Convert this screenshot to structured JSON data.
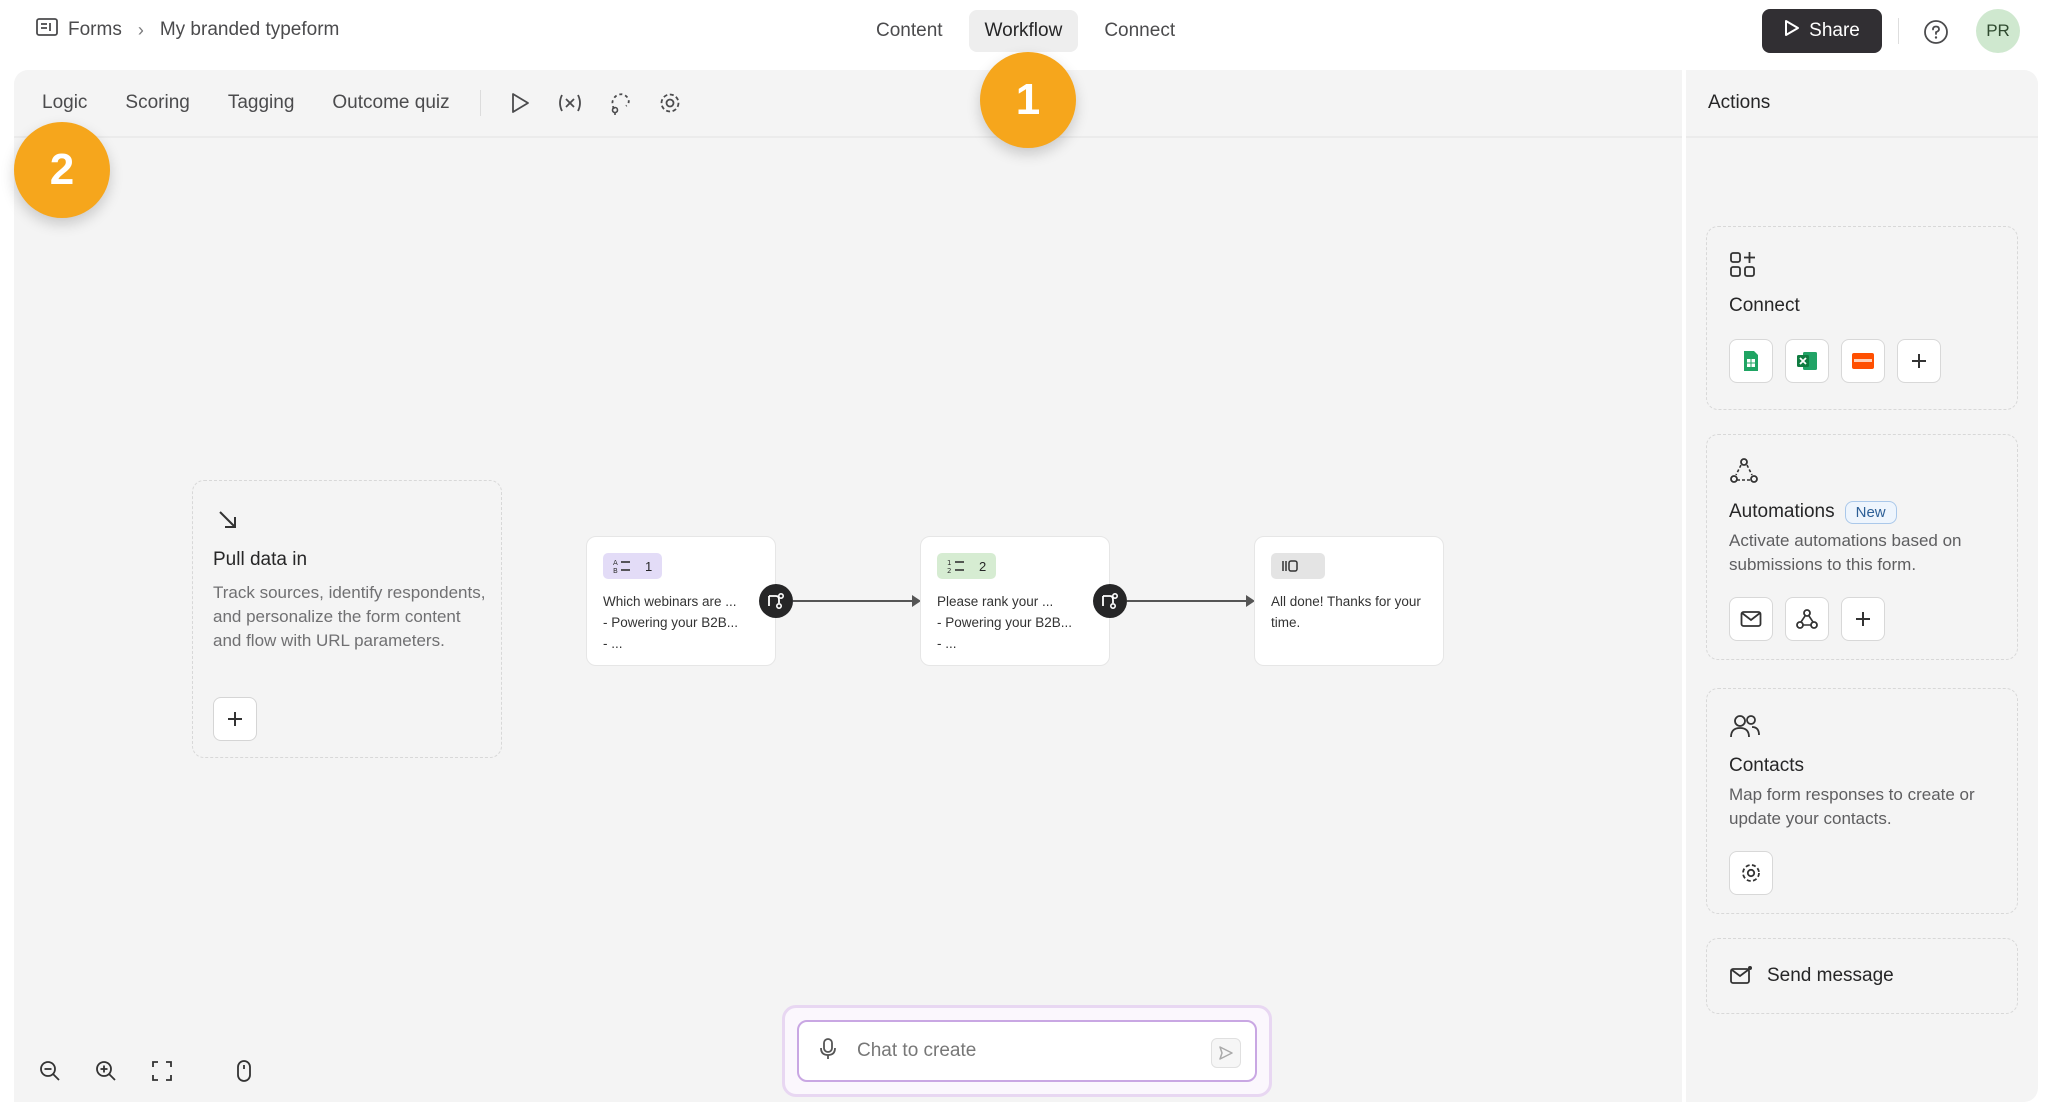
{
  "header": {
    "breadcrumb_root": "Forms",
    "breadcrumb_separator": "›",
    "breadcrumb_current": "My branded typeform",
    "tabs": [
      {
        "label": "Content"
      },
      {
        "label": "Workflow",
        "active": true
      },
      {
        "label": "Connect"
      }
    ],
    "share_label": "Share",
    "avatar_initials": "PR"
  },
  "subnav": {
    "tabs": [
      {
        "label": "Logic"
      },
      {
        "label": "Scoring"
      },
      {
        "label": "Tagging"
      },
      {
        "label": "Outcome quiz"
      }
    ]
  },
  "badges": {
    "one": "1",
    "two": "2",
    "color": "#f6a61c"
  },
  "pull_data": {
    "title": "Pull data in",
    "description": "Track sources, identify respondents, and personalize the form content and flow with URL parameters."
  },
  "nodes": [
    {
      "number": "1",
      "text": "Which webinars are ...\n- Powering your B2B...\n- ...",
      "tag_color": "#e3dcf7"
    },
    {
      "number": "2",
      "text": "Please rank your ...\n- Powering your B2B...\n- ...",
      "tag_color": "#d6ecd2"
    },
    {
      "number": "",
      "text": "All done! Thanks for your time.",
      "tag_color": "#e4e4e4"
    }
  ],
  "chat": {
    "placeholder": "Chat to create"
  },
  "actions": {
    "title": "Actions",
    "connect": {
      "title": "Connect"
    },
    "automations": {
      "title": "Automations",
      "badge": "New",
      "description": "Activate automations based on submissions to this form."
    },
    "contacts": {
      "title": "Contacts",
      "description": "Map form responses to create or update your contacts."
    },
    "send_message": {
      "label": "Send message"
    }
  }
}
